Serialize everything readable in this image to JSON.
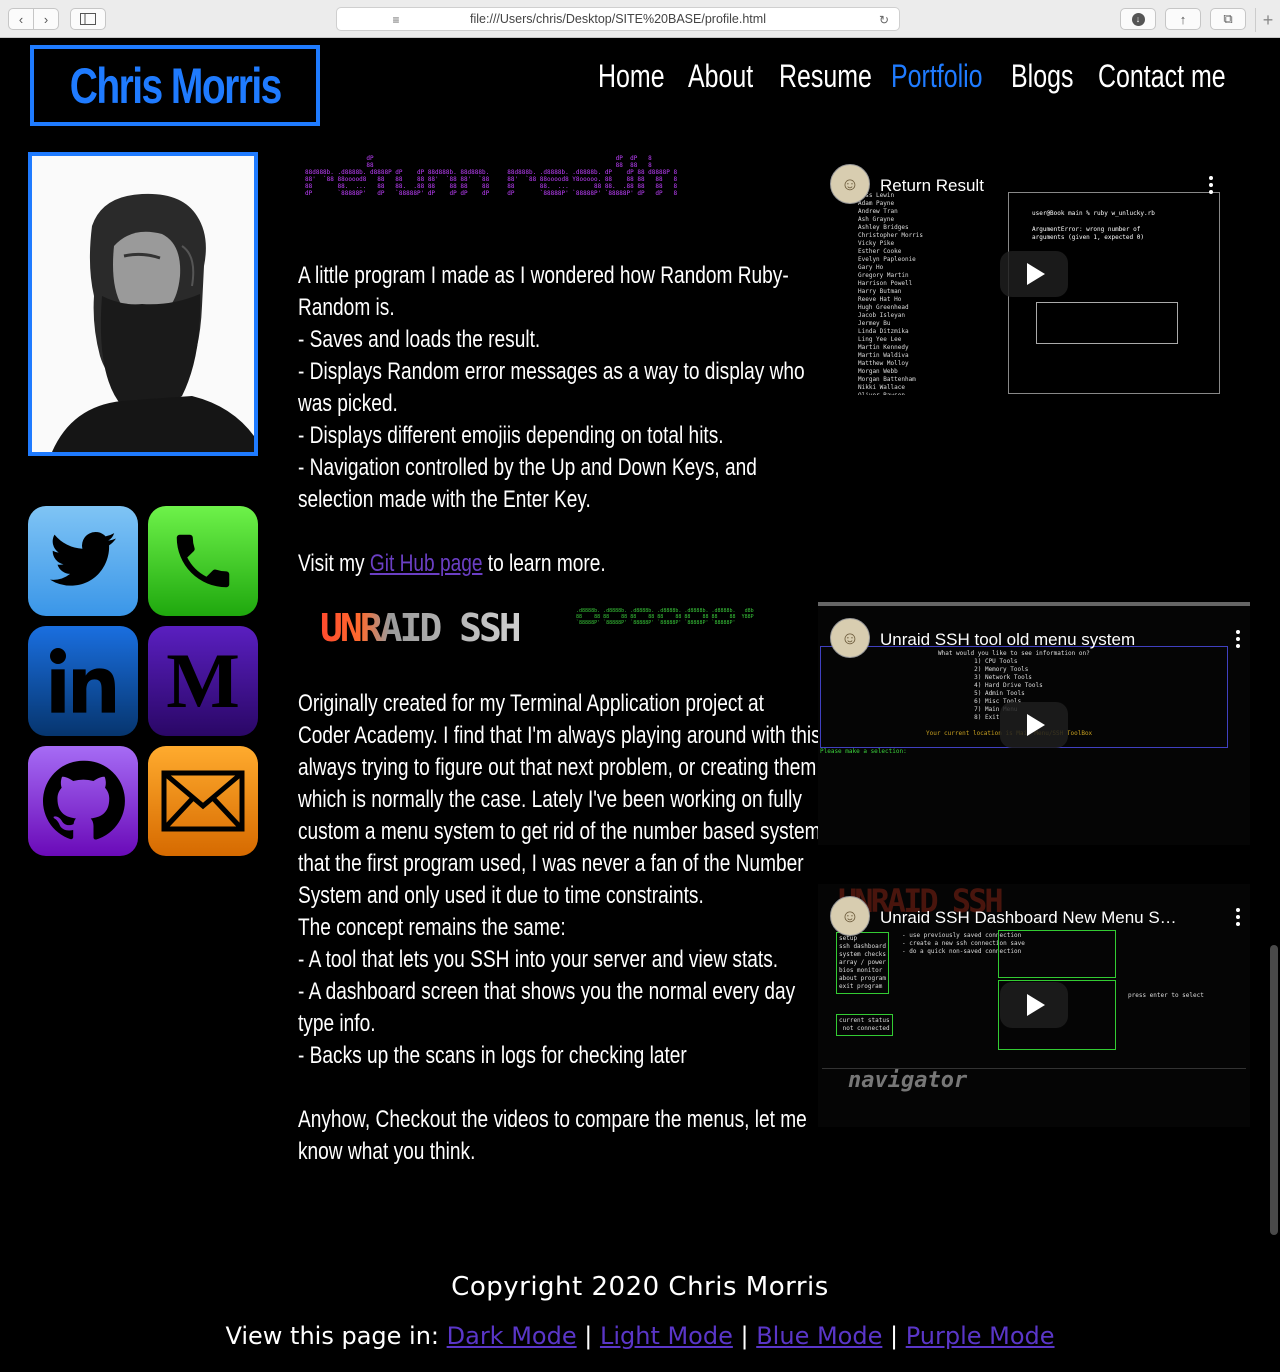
{
  "browser": {
    "url": "file:///Users/chris/Desktop/SITE%20BASE/profile.html"
  },
  "header": {
    "logo": "Chris Morris",
    "nav": [
      {
        "label": "Home",
        "active": false
      },
      {
        "label": "About",
        "active": false
      },
      {
        "label": "Resume",
        "active": false
      },
      {
        "label": "Portfolio",
        "active": true
      },
      {
        "label": "Blogs",
        "active": false
      },
      {
        "label": "Contact me",
        "active": false
      }
    ],
    "accent_color": "#1f7bff"
  },
  "social": [
    {
      "name": "twitter",
      "icon": "twitter-bird-icon",
      "color": "#55acee"
    },
    {
      "name": "phone",
      "icon": "phone-icon",
      "color": "#3bd11e"
    },
    {
      "name": "linkedin",
      "icon": "linkedin-icon",
      "color": "#0a66c2"
    },
    {
      "name": "medium",
      "icon": "medium-icon",
      "color": "#3d0a8a"
    },
    {
      "name": "github",
      "icon": "github-octocat-icon",
      "color": "#8a16d6"
    },
    {
      "name": "email",
      "icon": "envelope-icon",
      "color": "#f08a00"
    }
  ],
  "project1": {
    "lines": [
      "A little program I made as I wondered how Random Ruby-",
      "Random is.",
      "- Saves and loads the result.",
      "- Displays Random error messages as a way to display who",
      "was picked.",
      "- Displays different emojiis depending on total hits.",
      "- Navigation controlled by the Up and Down Keys, and",
      "selection made with the Enter Key."
    ],
    "visit_prefix": "Visit my ",
    "visit_link": "Git Hub page",
    "visit_suffix": " to learn more.",
    "video_title": "Return Result"
  },
  "project2": {
    "banner": "UNRAID SSH",
    "lines": [
      "Originally created for my Terminal Application project at",
      "Coder Academy. I find that I'm always playing around with this,",
      "always trying to figure out that next problem, or creating them",
      "which is normally the case. Lately I've been working on fully",
      "custom a menu system to get rid of the number based system",
      "that the first program used, I was never a fan of the Number",
      "System and only used it due to time constraints.",
      "The concept remains the same:",
      "- A tool that lets you SSH into your server and view stats.",
      "- A dashboard screen that shows you the normal every day",
      "type info.",
      "- Backs up the scans in logs for checking later",
      "",
      "Anyhow, Checkout the videos to compare the menus, let me",
      "know what you think."
    ],
    "video1_title": "Unraid SSH tool old menu system",
    "video2_title": "Unraid SSH Dashboard New Menu S…"
  },
  "footer": {
    "copyright": "Copyright 2020 Chris Morris",
    "modes_prefix": "View this page in: ",
    "modes": [
      "Dark Mode",
      "Light Mode",
      "Blue Mode",
      "Purple Mode"
    ],
    "separator": " | "
  }
}
